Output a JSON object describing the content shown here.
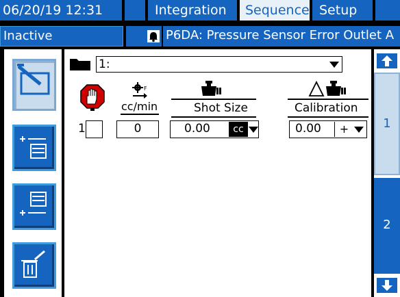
{
  "header": {
    "datetime": "06/20/19 12:31",
    "tabs": [
      {
        "label": "Integration",
        "selected": false
      },
      {
        "label": "Sequence",
        "selected": true
      },
      {
        "label": "Setup",
        "selected": false
      }
    ]
  },
  "status": {
    "state": "Inactive",
    "error_icon": "bell-alert-icon",
    "error_text": "P6DA: Pressure Sensor Error Outlet A"
  },
  "sidebar": {
    "buttons": [
      {
        "name": "edit-sequence-button",
        "icon": "edit-screen-icon"
      },
      {
        "name": "insert-step-above-button",
        "icon": "insert-above-icon"
      },
      {
        "name": "insert-step-below-button",
        "icon": "insert-below-icon"
      },
      {
        "name": "delete-step-button",
        "icon": "trash-icon"
      }
    ]
  },
  "main": {
    "sequence_select": {
      "value": "1:",
      "icon": "folder-icon"
    },
    "columns": {
      "stop_icon": "stop-hand-icon",
      "flow_icon": "flow-rate-icon",
      "flow_unit": "cc/min",
      "shot_icon": "dispense-valve-icon",
      "shot_label": "Shot Size",
      "cal_icon": "delta-dispense-valve-icon",
      "cal_label": "Calibration"
    },
    "row": {
      "step": "1",
      "flow_value": "0",
      "shot_value": "0.00",
      "shot_unit": "cc",
      "cal_value": "0.00",
      "cal_sign": "+"
    }
  },
  "pager": {
    "pages": [
      "1",
      "2"
    ],
    "current_page": "1",
    "up_icon": "arrow-up-icon",
    "down_icon": "arrow-down-icon"
  },
  "colors": {
    "accent": "#1565c0",
    "selected_tab": "#e8f0f8",
    "background": "#000000",
    "alert": "#d00000"
  }
}
